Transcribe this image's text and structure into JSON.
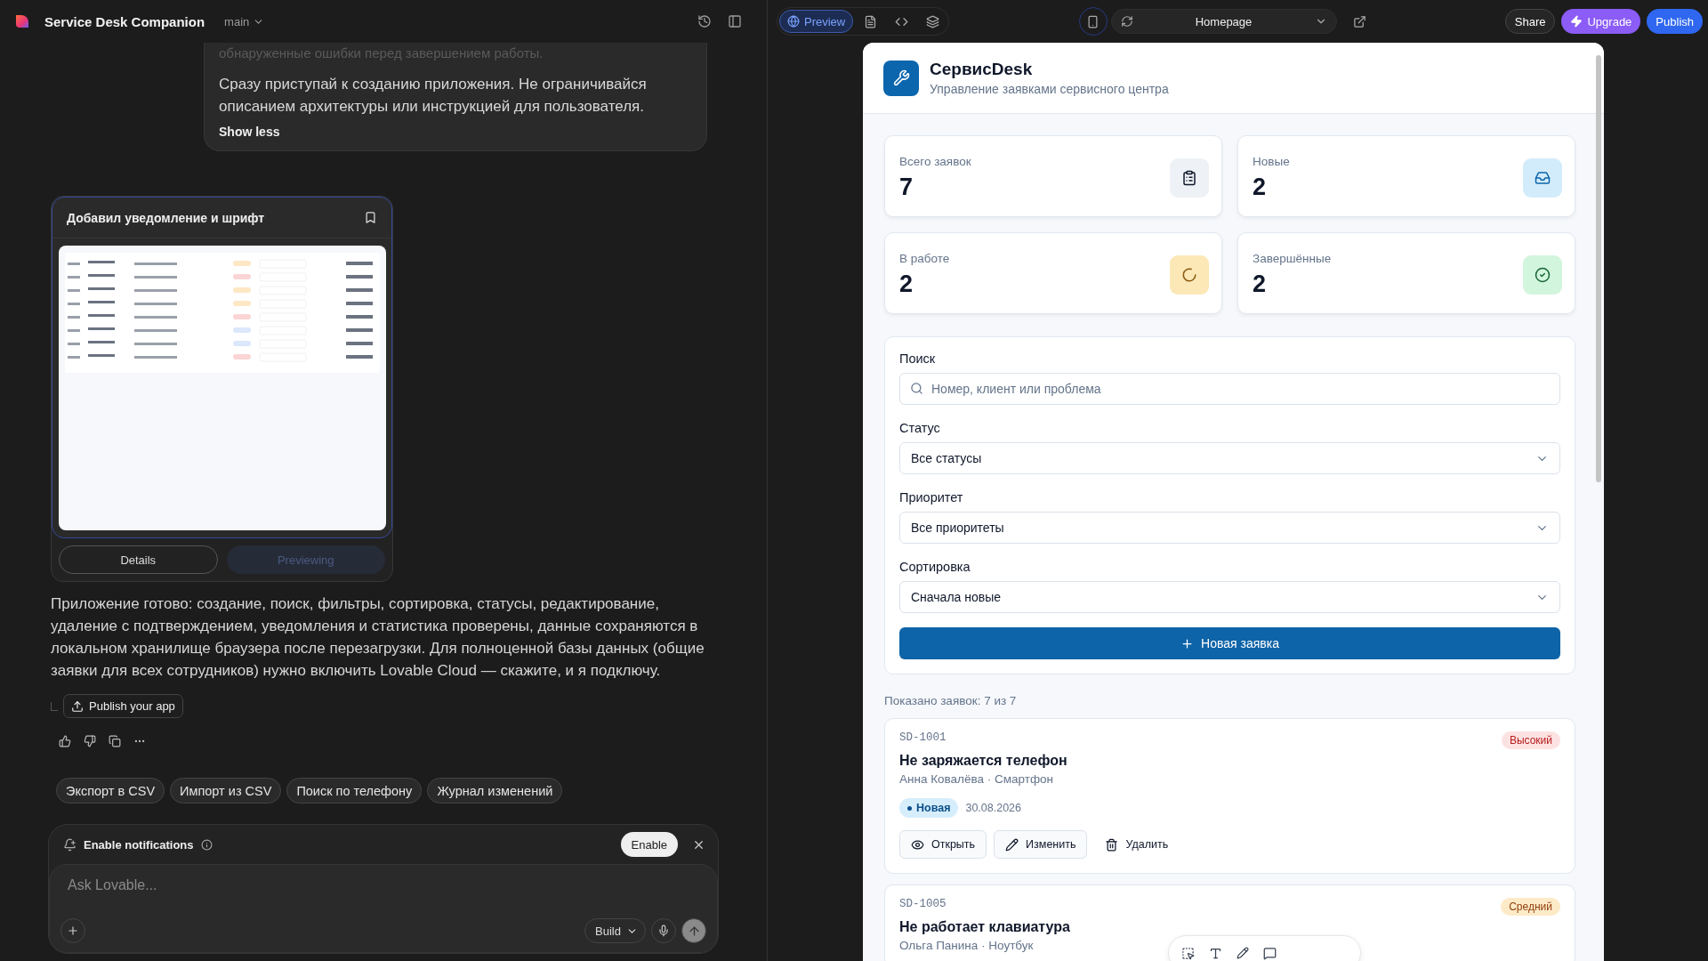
{
  "app": {
    "name": "Service Desk Companion",
    "branch": "main"
  },
  "chat": {
    "prev_message": {
      "faded_line": "обнаруженные ошибки перед завершением работы.",
      "text": "Сразу приступай к созданию приложения. Не ограничивайся описанием архитектуры или инструкцией для пользователя.",
      "toggle": "Show less"
    },
    "version_card": {
      "title": "Добавил уведомление и шрифт",
      "tabs": [
        {
          "label": "Details",
          "selected": false
        },
        {
          "label": "Previewing",
          "selected": true
        }
      ]
    },
    "reply": "Приложение готово: создание, поиск, фильтры, сортировка, статусы, редактирование, удаление с подтверждением, уведомления и статистика проверены, данные сохраняются в локальном хранилище браузера после перезагрузки. Для полноценной базы данных (общие заявки для всех сотрудников) нужно включить Lovable Cloud — скажите, и я подключу.",
    "publish_button": "Publish your app",
    "suggestions": [
      "Экспорт в CSV",
      "Импорт из CSV",
      "Поиск по телефону",
      "Журнал изменений"
    ],
    "notification": {
      "label": "Enable notifications",
      "button": "Enable"
    },
    "composer": {
      "placeholder": "Ask Lovable...",
      "mode": "Build"
    }
  },
  "toolbar": {
    "views": [
      {
        "kind": "preview",
        "label": "Preview",
        "selected": true
      },
      {
        "kind": "files",
        "selected": false
      },
      {
        "kind": "code",
        "selected": false
      },
      {
        "kind": "layers",
        "selected": false
      }
    ],
    "page": "Homepage",
    "share": "Share",
    "upgrade": "Upgrade",
    "publish": "Publish"
  },
  "preview": {
    "title": "СервисDesk",
    "subtitle": "Управление заявками сервисного центра",
    "stats": [
      {
        "label": "Всего заявок",
        "value": "7",
        "kind": "total"
      },
      {
        "label": "Новые",
        "value": "2",
        "kind": "new"
      },
      {
        "label": "В работе",
        "value": "2",
        "kind": "progress"
      },
      {
        "label": "Завершённые",
        "value": "2",
        "kind": "done"
      }
    ],
    "filters": {
      "search": {
        "label": "Поиск",
        "placeholder": "Номер, клиент или проблема"
      },
      "selects": [
        {
          "label": "Статус",
          "value": "Все статусы"
        },
        {
          "label": "Приоритет",
          "value": "Все приоритеты"
        },
        {
          "label": "Сортировка",
          "value": "Сначала новые"
        }
      ],
      "new_button": "Новая заявка"
    },
    "count": "Показано заявок: 7 из 7",
    "tickets": [
      {
        "id": "SD-1001",
        "title": "Не заряжается телефон",
        "meta": "Анна Ковалёва · Смартфон",
        "priority": "Высокий",
        "kind": "high",
        "status": "Новая",
        "date": "30.08.2026",
        "actions": [
          "Открыть",
          "Изменить",
          "Удалить"
        ]
      },
      {
        "id": "SD-1005",
        "title": "Не работает клавиатура",
        "meta": "Ольга Панина · Ноутбук",
        "priority": "Средний",
        "kind": "medium"
      }
    ]
  }
}
